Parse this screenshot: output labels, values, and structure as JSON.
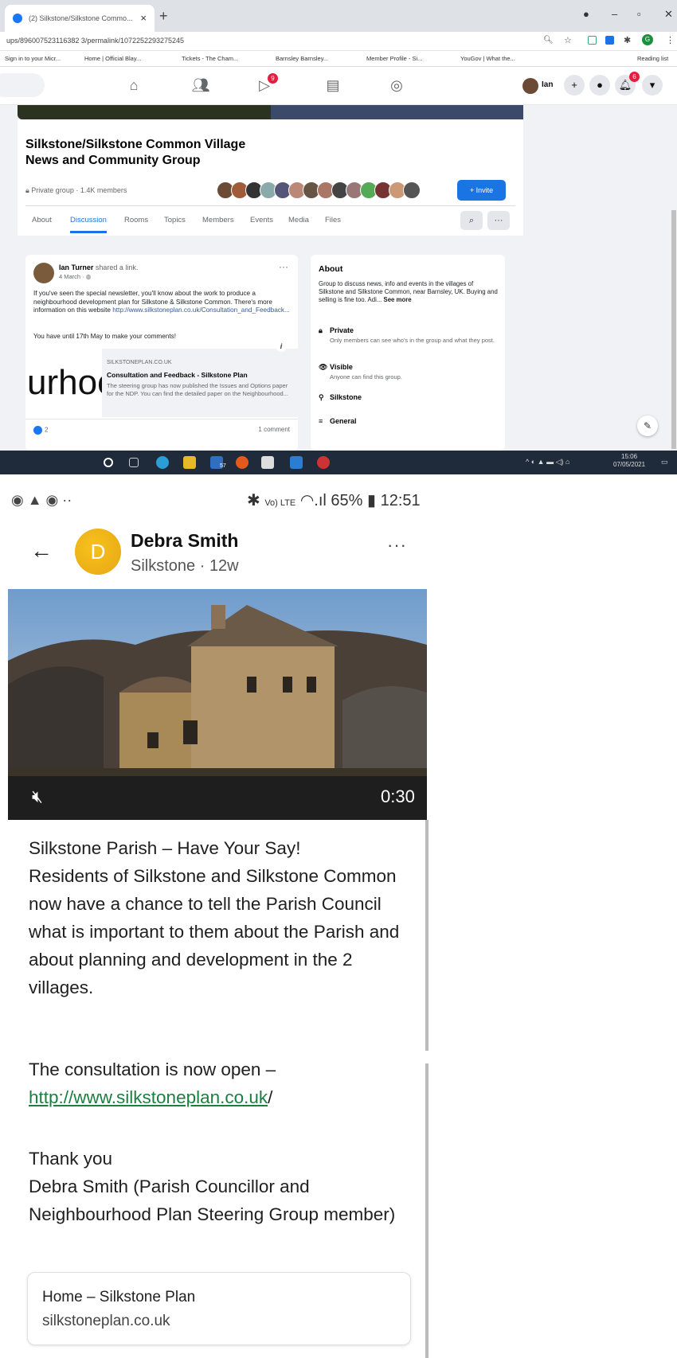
{
  "browser": {
    "tab_title": "(2) Silkstone/Silkstone Commo...",
    "url": "ups/896007523116382 3/permalink/1072252293275245",
    "bookmarks": [
      "Sign in to your Micr...",
      "Home | Official Blay...",
      "Tickets - The Cham...",
      "Barnsley Barnsley...",
      "Member Profile - Si...",
      "YouGov | What the...",
      "Reading list"
    ],
    "profile_initial": "G"
  },
  "fb": {
    "user_name": "Ian",
    "video_badge": "9",
    "notif_badge": "6",
    "group_title": "Silkstone/Silkstone Common Village News and Community Group",
    "group_meta": "Private group · 1.4K members",
    "invite_label": "+ Invite",
    "tabs": [
      "About",
      "Discussion",
      "Rooms",
      "Topics",
      "Members",
      "Events",
      "Media",
      "Files"
    ],
    "post": {
      "author": "Ian Turner",
      "action": "shared a link.",
      "date": "4 March · ",
      "text": "If you've seen the special newsletter, you'll know about the work to produce a neighbourhood development plan for Silkstone & Silkstone Common. There's more information on this website",
      "link": "http://www.silkstoneplan.co.uk/Consultation_and_Feedback...",
      "note": "You have until 17th May to make your comments!",
      "preview_image_text": "urhoo",
      "preview_domain": "SILKSTONEPLAN.CO.UK",
      "preview_title": "Consultation and Feedback - Silkstone Plan",
      "preview_desc": "The steering group has now published the Issues and Options paper for the NDP. You can find the detailed paper on the Neighbourhood...",
      "likes": "2",
      "comments": "1 comment"
    },
    "about": {
      "heading": "About",
      "desc": "Group to discuss news, info and events in the villages of Silkstone and Silkstone Common, near Barnsley, UK. Buying and selling is fine too. Adi...",
      "see_more": "See more",
      "private_title": "Private",
      "private_sub": "Only members can see who's in the group and what they post.",
      "visible_title": "Visible",
      "visible_sub": "Anyone can find this group.",
      "location": "Silkstone",
      "category": "General"
    }
  },
  "taskbar": {
    "mail_count": "57",
    "time": "15:06",
    "date": "07/05/2021"
  },
  "phone": {
    "battery": "65%",
    "time": "12:51",
    "network": "Vo) LTE",
    "avatar_initial": "D",
    "author": "Debra Smith",
    "location": "Silkstone",
    "age": "12w",
    "video_duration": "0:30",
    "paragraph1": "Silkstone Parish – Have Your Say!\nResidents of Silkstone and Silkstone Common now have a chance to tell the Parish Council what is important to them about the Parish and about planning and development in the 2 villages.",
    "paragraph2_lead": "The consultation is now open –",
    "paragraph2_url": "http://www.silkstoneplan.co.uk",
    "paragraph2_tail": "/",
    "paragraph3": "Thank you\nDebra Smith (Parish Councillor and Neighbourhood Plan Steering Group member)",
    "card_title": "Home – Silkstone Plan",
    "card_domain": "silkstoneplan.co.uk"
  },
  "colors": {
    "fb_blue": "#1b74e4",
    "link_green": "#1a7f3f",
    "avatar_yellow": "#f6c21c"
  },
  "icons": [
    "home-icon",
    "friends-icon",
    "watch-icon",
    "marketplace-icon",
    "groups-icon",
    "search-icon",
    "more-icon",
    "lock-icon",
    "eye-icon",
    "pin-icon",
    "list-icon",
    "mute-icon",
    "back-arrow-icon",
    "edit-icon"
  ]
}
